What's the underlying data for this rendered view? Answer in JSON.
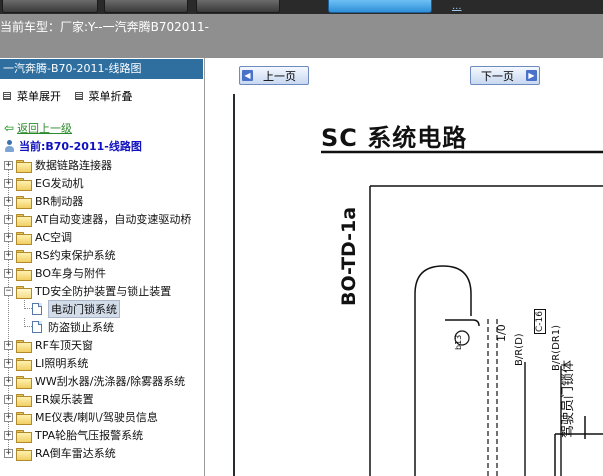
{
  "topbar": {
    "link_text": "..."
  },
  "vehicle_bar": {
    "text": "当前车型：厂家:Y--一汽奔腾B702011-"
  },
  "left_panel": {
    "header": "一汽奔腾-B70-2011-线路图",
    "expand_all": "菜单展开",
    "collapse_all": "菜单折叠",
    "back": "返回上一级",
    "current": "当前:B70-2011-线路图",
    "tree": [
      {
        "label": "数据链路连接器"
      },
      {
        "label": "EG发动机"
      },
      {
        "label": "BR制动器"
      },
      {
        "label": "AT自动变速器，自动变速驱动桥"
      },
      {
        "label": "AC空调"
      },
      {
        "label": "RS约束保护系统"
      },
      {
        "label": "BO车身与附件"
      },
      {
        "label": "TD安全防护装置与锁止装置"
      },
      {
        "label": "电动门锁系统"
      },
      {
        "label": "防盗锁止系统"
      },
      {
        "label": "RF车顶天窗"
      },
      {
        "label": "LI照明系统"
      },
      {
        "label": "WW刮水器/洗涤器/除雾器系统"
      },
      {
        "label": "ER娱乐装置"
      },
      {
        "label": "ME仪表/喇叭/驾驶员信息"
      },
      {
        "label": "TPA轮胎气压报警系统"
      },
      {
        "label": "RA倒车雷达系统"
      }
    ]
  },
  "viewer": {
    "prev_page": "上一页",
    "next_page": "下一页"
  },
  "diagram": {
    "title": "SC 系统电路",
    "code": "BO-TD-1a",
    "connector_b13": "b13",
    "wire_1_0": "1/0",
    "wire_brd": "B/R(D)",
    "connector_c16": "C-16",
    "wire_brdr1": "B/R(DR1)",
    "door_lock_label": "驾驶员门锁体"
  }
}
